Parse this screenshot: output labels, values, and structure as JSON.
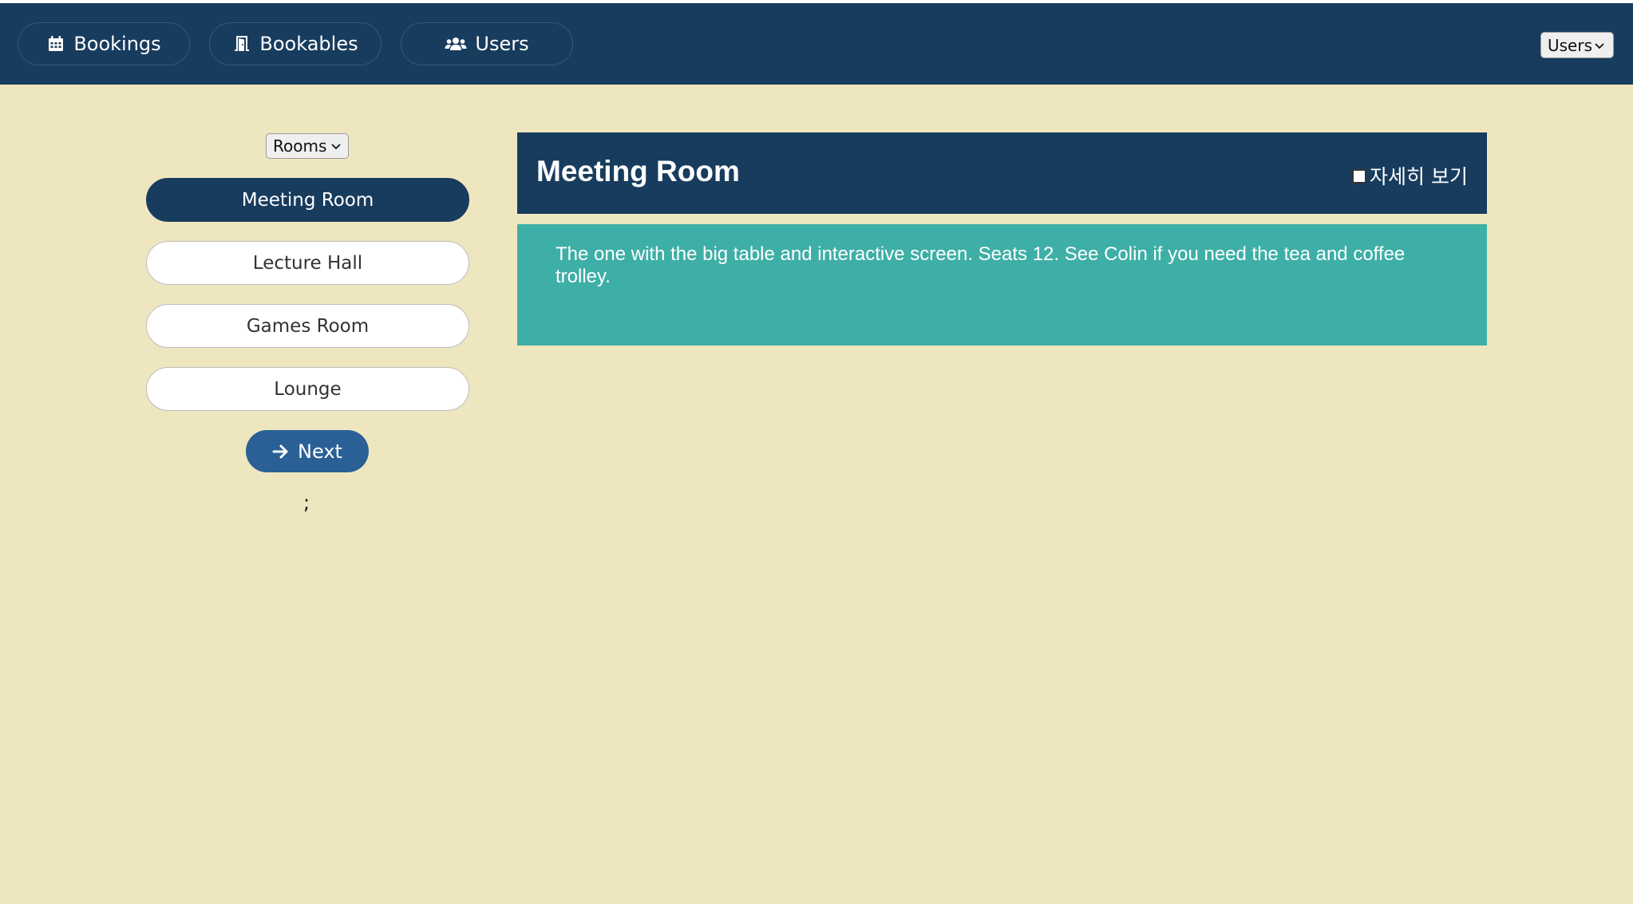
{
  "nav": {
    "items": [
      {
        "label": "Bookings",
        "icon": "calendar-icon"
      },
      {
        "label": "Bookables",
        "icon": "door-icon"
      },
      {
        "label": "Users",
        "icon": "users-icon"
      }
    ],
    "user_select": {
      "value": "Users"
    }
  },
  "sidebar": {
    "group_select": {
      "value": "Rooms"
    },
    "items": [
      {
        "label": "Meeting Room",
        "active": true
      },
      {
        "label": "Lecture Hall",
        "active": false
      },
      {
        "label": "Games Room",
        "active": false
      },
      {
        "label": "Lounge",
        "active": false
      }
    ],
    "next_label": "Next",
    "trailing_text": ";"
  },
  "details": {
    "title": "Meeting Room",
    "toggle_label": "자세히 보기",
    "toggle_checked": false,
    "description": "The one with the big table and interactive screen. Seats 12. See Colin if you need the tea and coffee trolley."
  },
  "colors": {
    "navy": "#183C5E",
    "page_bg": "#EEE6BF",
    "teal": "#3EAFA6",
    "next_button": "#2A6096"
  }
}
